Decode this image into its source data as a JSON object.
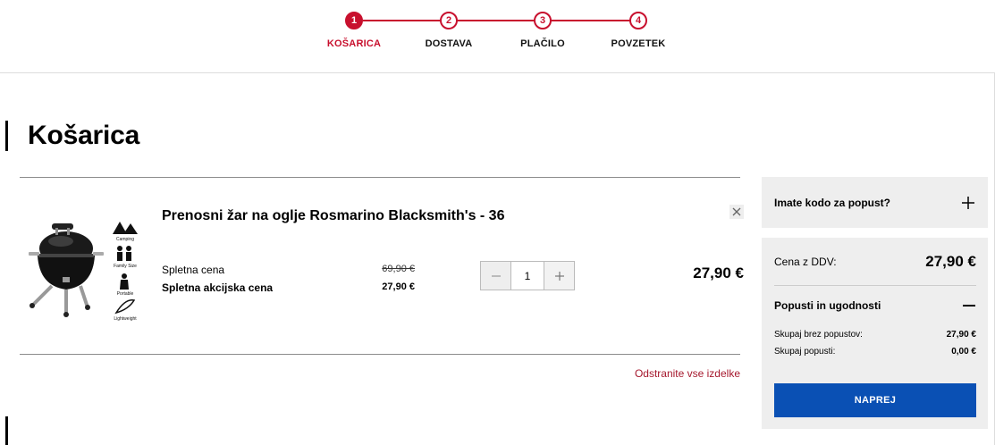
{
  "stepper": {
    "steps": [
      {
        "num": "1",
        "label": "KOŠARICA"
      },
      {
        "num": "2",
        "label": "DOSTAVA"
      },
      {
        "num": "3",
        "label": "PLAČILO"
      },
      {
        "num": "4",
        "label": "POVZETEK"
      }
    ],
    "active_step": 1
  },
  "page": {
    "title": "Košarica"
  },
  "cart": {
    "item": {
      "name": "Prenosni žar na oglje Rosmarino Blacksmith's - 36",
      "image_badges": [
        "Camping",
        "Family Size",
        "Portable",
        "Lightweight"
      ],
      "online_price_label": "Spletna cena",
      "online_price": "69,90 €",
      "sale_price_label": "Spletna akcijska cena",
      "sale_price": "27,90 €",
      "quantity": "1",
      "line_total": "27,90 €"
    },
    "remove_all": "Odstranite vse izdelke"
  },
  "sidebar": {
    "coupon_label": "Imate kodo za popust?",
    "price_label": "Cena z DDV:",
    "price_value": "27,90 €",
    "discounts_label": "Popusti in ugodnosti",
    "total_without_label": "Skupaj brez popustov:",
    "total_without_value": "27,90 €",
    "total_discounts_label": "Skupaj popusti:",
    "total_discounts_value": "0,00 €",
    "next_button": "NAPREJ"
  },
  "colors": {
    "accent_red": "#c8102e",
    "primary_blue": "#0a50b4",
    "panel_gray": "#eeeeee"
  }
}
